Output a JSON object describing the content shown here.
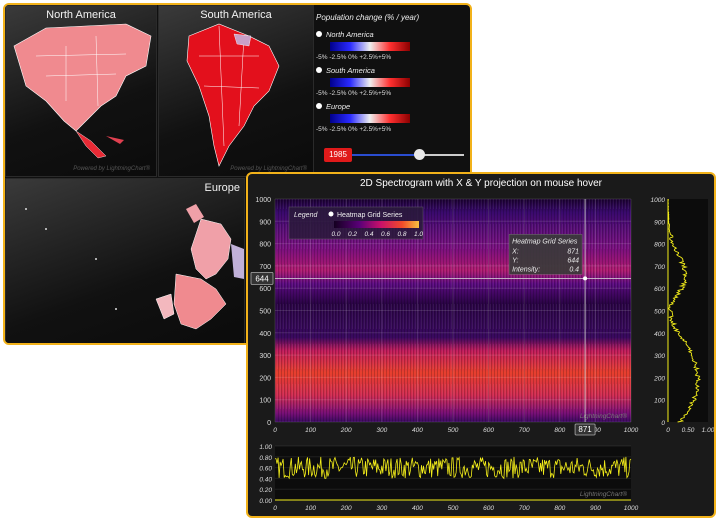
{
  "maps": {
    "north_america_title": "North America",
    "south_america_title": "South America",
    "europe_title": "Europe",
    "legend_title": "Population change (% / year)",
    "legend_rows": [
      "North America",
      "South America",
      "Europe"
    ],
    "legend_ticks": "-5%  -2.5%  0%  +2.5%+5%",
    "year": "1985",
    "year_slider_fraction": 0.6,
    "powered_by": "Powered by LightningChart®",
    "colors": {
      "frame": "#f2b21a",
      "na": "#f08a8f",
      "sa": "#e3101c"
    }
  },
  "spectrogram": {
    "title": "2D Spectrogram with X & Y projection on mouse hover",
    "legend_label": "Legend",
    "series_name": "Heatmap Grid Series",
    "legend_ticks": [
      "0.0",
      "0.2",
      "0.4",
      "0.6",
      "0.8",
      "1.0"
    ],
    "tooltip": {
      "series": "Heatmap Grid Series",
      "x_label": "X:",
      "x_value": "871",
      "y_label": "Y:",
      "y_value": "644",
      "intensity_label": "Intensity:",
      "intensity_value": "0.4"
    },
    "cursor_x_label": "871",
    "cursor_y_label": "644",
    "logo": "LightningChart®"
  },
  "chart_data": [
    {
      "type": "heatmap",
      "title": "2D Spectrogram with X & Y projection on mouse hover",
      "xlim": [
        0,
        1000
      ],
      "ylim": [
        0,
        1000
      ],
      "x_ticks": [
        "0",
        "100",
        "200",
        "300",
        "400",
        "500",
        "600",
        "700",
        "800",
        "900",
        "1000"
      ],
      "y_ticks": [
        "0",
        "100",
        "200",
        "300",
        "400",
        "500",
        "600",
        "700",
        "800",
        "900",
        "1000"
      ],
      "cursor": {
        "x": 871,
        "y": 644,
        "intensity": 0.4
      },
      "intensity_range": [
        0,
        1
      ],
      "bands": [
        {
          "y_center": 170,
          "y_halfwidth": 130,
          "intensity": 0.75
        },
        {
          "y_center": 650,
          "y_halfwidth": 110,
          "intensity": 0.45
        }
      ]
    },
    {
      "type": "line",
      "name": "Y projection",
      "xlim": [
        0,
        1
      ],
      "ylim": [
        0,
        1000
      ],
      "x_ticks": [
        "0",
        "0.50",
        "1.00"
      ],
      "y_ticks": [
        "0",
        "100",
        "200",
        "300",
        "400",
        "500",
        "600",
        "700",
        "800",
        "900",
        "1000"
      ],
      "y": [
        0,
        50,
        100,
        150,
        200,
        250,
        300,
        350,
        400,
        450,
        500,
        550,
        600,
        650,
        700,
        750,
        800,
        850,
        900,
        950,
        1000
      ],
      "x": [
        0.3,
        0.5,
        0.65,
        0.72,
        0.75,
        0.7,
        0.6,
        0.45,
        0.25,
        0.1,
        0.05,
        0.15,
        0.35,
        0.45,
        0.4,
        0.25,
        0.1,
        0.04,
        0.02,
        0.01,
        0.0
      ]
    },
    {
      "type": "line",
      "name": "X projection",
      "xlim": [
        0,
        1000
      ],
      "ylim": [
        0,
        1
      ],
      "x_ticks": [
        "0",
        "100",
        "200",
        "300",
        "400",
        "500",
        "600",
        "700",
        "800",
        "900",
        "1000"
      ],
      "y_ticks": [
        "0.00",
        "0.20",
        "0.40",
        "0.60",
        "0.80",
        "1.00"
      ],
      "mean": 0.6,
      "spread": [
        0.4,
        0.8
      ]
    }
  ]
}
